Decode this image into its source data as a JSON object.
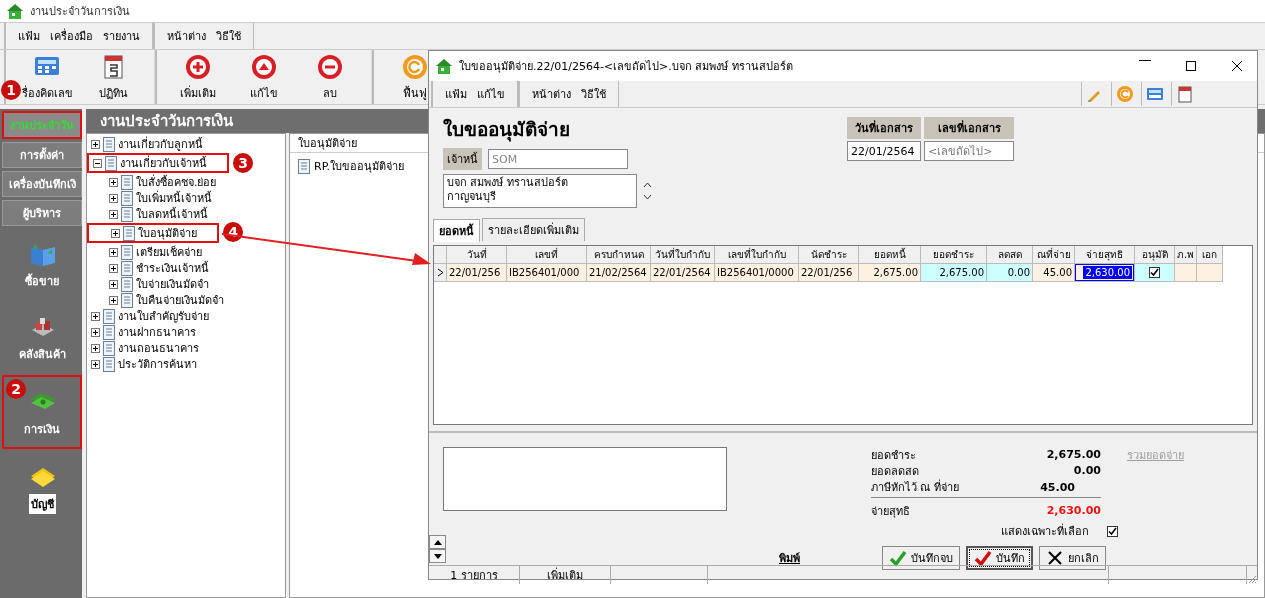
{
  "app": {
    "title": "งานประจำวันการเงิน",
    "menu_groups": [
      {
        "items": [
          "แฟ้ม",
          "เครื่องมือ",
          "รายงาน"
        ]
      },
      {
        "items": [
          "หน้าต่าง",
          "วิธีใช้"
        ]
      }
    ],
    "toolbar_groups": [
      {
        "buttons": [
          {
            "label": "รื่องคิดเลข",
            "kind": "calculator"
          },
          {
            "label": "ปฏิทิน",
            "kind": "calendar"
          }
        ]
      },
      {
        "buttons": [
          {
            "label": "เพิ่มเติม",
            "kind": "add"
          },
          {
            "label": "แก้ไข",
            "kind": "edit"
          },
          {
            "label": "ลบ",
            "kind": "delete"
          }
        ]
      },
      {
        "buttons": [
          {
            "label": "ฟื้นฟู",
            "kind": "refresh"
          }
        ]
      }
    ],
    "nav_tabs": [
      {
        "label": "งานประจำวัน",
        "selected": true
      },
      {
        "label": "การตั้งค่า",
        "selected": false
      },
      {
        "label": "เครื่องบันทึกเงิ",
        "selected": false
      },
      {
        "label": "ผู้บริหาร",
        "selected": false
      }
    ],
    "nav_items": [
      {
        "label": "ซื้อขาย",
        "kind": "book",
        "selected": false
      },
      {
        "label": "คลังสินค้า",
        "kind": "warehouse",
        "selected": false
      },
      {
        "label": "การเงิน",
        "kind": "money",
        "selected": false
      },
      {
        "label": "บัญชี",
        "kind": "ledger",
        "selected": true
      }
    ],
    "panel_title": "งานประจำวันการเงิน",
    "tree": [
      {
        "label": "งานเกี่ยวกับลูกหนี้",
        "expanded": false
      },
      {
        "label": "งานเกี่ยวกับเจ้าหนี้",
        "expanded": true,
        "children": [
          {
            "label": "ใบสั่งซื้อคชจ.ย่อย",
            "expanded": false
          },
          {
            "label": "ใบเพิ่มหนี้เจ้าหนี้",
            "expanded": false
          },
          {
            "label": "ใบลดหนี้เจ้าหนี้",
            "expanded": false
          },
          {
            "label": "ใบอนุมัติจ่าย",
            "expanded": false
          },
          {
            "label": "เตรียมเช็คจ่าย",
            "expanded": false
          },
          {
            "label": "ชำระเงินเจ้าหนี้",
            "expanded": false
          },
          {
            "label": "ใบจ่ายเงินมัดจำ",
            "expanded": false
          },
          {
            "label": "ใบคืนจ่ายเงินมัดจำ",
            "expanded": false
          }
        ]
      },
      {
        "label": "งานใบสำคัญรับจ่าย",
        "expanded": false
      },
      {
        "label": "งานฝากธนาคาร",
        "expanded": false
      },
      {
        "label": "งานถอนธนาคาร",
        "expanded": false
      },
      {
        "label": "ประวัติการค้นหา",
        "expanded": false
      }
    ],
    "list": {
      "header": "ใบอนุมัติจ่าย",
      "items": [
        "RP.ใบขออนุมัติจ่าย"
      ]
    }
  },
  "dialog": {
    "title": "ใบขออนุมัติจ่าย.22/01/2564-<เลขถัดไป>.บจก สมพงษ์ ทรานสปอร์ต",
    "menu_groups": [
      {
        "items": [
          "แฟ้ม",
          "แก้ไข"
        ]
      },
      {
        "items": [
          "หน้าต่าง",
          "วิธีใช้"
        ]
      }
    ],
    "heading": "ใบขออนุมัติจ่าย",
    "creditor": {
      "label": "เจ้าหนี้",
      "value": "SOM",
      "disabled": true
    },
    "address": "บจก สมพงษ์ ทรานสปอร์ต\nกาญจนบุรี",
    "doc_date": {
      "label": "วันที่เอกสาร",
      "value": "22/01/2564"
    },
    "doc_number": {
      "label": "เลขที่เอกสาร",
      "placeholder": "<เลขถัดไป>"
    },
    "tabs": [
      {
        "label": "ยอดหนี้",
        "selected": true
      },
      {
        "label": "รายละเอียดเพิ่มเติม",
        "selected": false
      }
    ],
    "table": {
      "columns": [
        {
          "label": "วันที่",
          "editable": false
        },
        {
          "label": "เลขที่",
          "editable": false
        },
        {
          "label": "ครบกำหนด",
          "editable": false
        },
        {
          "label": "วันที่ใบกำกับ",
          "editable": false
        },
        {
          "label": "เลขที่ใบกำกับ",
          "editable": false
        },
        {
          "label": "นัดชำระ",
          "editable": false
        },
        {
          "label": "ยอดหนี้",
          "editable": false
        },
        {
          "label": "ยอดชำระ",
          "editable": true
        },
        {
          "label": "ลดสด",
          "editable": true
        },
        {
          "label": "ณที่จ่าย",
          "editable": false
        },
        {
          "label": "จ่ายสุทธิ",
          "editable": false
        },
        {
          "label": "อนุมัติ",
          "editable": true
        },
        {
          "label": "ภ.พ",
          "editable": false
        },
        {
          "label": "เอก",
          "editable": false
        }
      ],
      "rows": [
        {
          "current": true,
          "cells": [
            {
              "kind": "text",
              "text": "22/01/256",
              "selected": false
            },
            {
              "kind": "text",
              "text": "IB256401/000",
              "selected": false
            },
            {
              "kind": "text",
              "text": "21/02/2564",
              "selected": false
            },
            {
              "kind": "text",
              "text": "22/01/2564",
              "selected": false
            },
            {
              "kind": "text",
              "text": "IB256401/0000",
              "selected": false
            },
            {
              "kind": "text",
              "text": "22/01/256",
              "selected": false
            },
            {
              "kind": "number",
              "text": "2,675.00",
              "selected": false
            },
            {
              "kind": "number",
              "text": "2,675.00",
              "selected": false
            },
            {
              "kind": "number",
              "text": "0.00",
              "selected": false
            },
            {
              "kind": "number",
              "text": "45.00",
              "selected": false
            },
            {
              "kind": "number",
              "text": "2,630.00",
              "selected": true
            },
            {
              "kind": "checkbox",
              "checked": true,
              "selected": false
            },
            {
              "kind": "empty",
              "selected": false
            },
            {
              "kind": "empty",
              "selected": false
            }
          ]
        }
      ]
    },
    "summary": [
      {
        "label": "ยอดชำระ",
        "value": "2,675.00",
        "kind": "line"
      },
      {
        "label": "ยอดลดสด",
        "value": "0.00",
        "kind": "line"
      },
      {
        "label": "ภาษีหักไว้ ณ ที่จ่าย",
        "value": "45.00",
        "kind": "line"
      },
      {
        "label": "จ่ายสุทธิ",
        "value": "2,630.00",
        "kind": "total"
      }
    ],
    "sum_link": {
      "label": "รวมยอดจ่าย",
      "disabled": true
    },
    "show_selected": {
      "label": "แสดงเฉพาะที่เลือก",
      "checked": true
    },
    "print_link": "พิมพ์",
    "buttons": [
      {
        "label": "บันทึกจบ",
        "kind": "save_close",
        "focused": false
      },
      {
        "label": "บันทึก",
        "kind": "save",
        "focused": true
      },
      {
        "label": "ยกเลิก",
        "kind": "cancel",
        "focused": false
      }
    ],
    "status_bar": [
      "1 รายการ",
      "เพิ่มเติม"
    ]
  },
  "annotations": {
    "badges": [
      "1",
      "2",
      "3",
      "4"
    ]
  }
}
